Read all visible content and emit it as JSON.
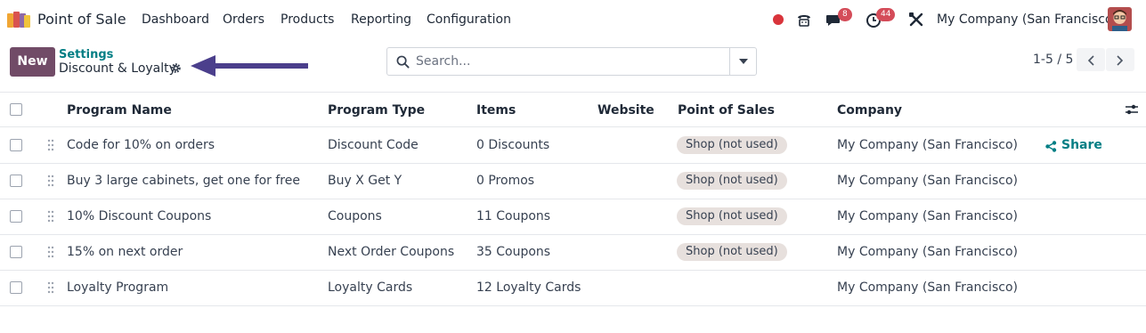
{
  "navbar": {
    "app_name": "Point of Sale",
    "menu": [
      "Dashboard",
      "Orders",
      "Products",
      "Reporting",
      "Configuration"
    ],
    "messages_badge": "8",
    "activities_badge": "44",
    "company": "My Company (San Francisco)",
    "icons": [
      "status-dot-icon",
      "phone-icon",
      "chat-icon",
      "clock-icon",
      "tools-icon"
    ],
    "status_color": "#d9343b"
  },
  "control_panel": {
    "new_label": "New",
    "breadcrumb_parent": "Settings",
    "breadcrumb_current": "Discount & Loyalty",
    "search_placeholder": "Search...",
    "pager": "1-5 / 5"
  },
  "table": {
    "columns": [
      "Program Name",
      "Program Type",
      "Items",
      "Website",
      "Point of Sales",
      "Company"
    ],
    "rows": [
      {
        "name": "Code for 10% on orders",
        "type": "Discount Code",
        "items": "0 Discounts",
        "pos": "Shop (not used)",
        "company": "My Company (San Francisco)",
        "share": "Share"
      },
      {
        "name": "Buy 3 large cabinets, get one for free",
        "type": "Buy X Get Y",
        "items": "0 Promos",
        "pos": "Shop (not used)",
        "company": "My Company (San Francisco)"
      },
      {
        "name": "10% Discount Coupons",
        "type": "Coupons",
        "items": "11 Coupons",
        "pos": "Shop (not used)",
        "company": "My Company (San Francisco)"
      },
      {
        "name": "15% on next order",
        "type": "Next Order Coupons",
        "items": "35 Coupons",
        "pos": "Shop (not used)",
        "company": "My Company (San Francisco)"
      },
      {
        "name": "Loyalty Program",
        "type": "Loyalty Cards",
        "items": "12 Loyalty Cards",
        "pos": "",
        "company": "My Company (San Francisco)"
      }
    ]
  },
  "colors": {
    "primary": "#714b67",
    "link": "#017e84",
    "badge": "#d44c59",
    "tag_bg": "#e7e0dd",
    "arrow": "#4b3f8c"
  }
}
